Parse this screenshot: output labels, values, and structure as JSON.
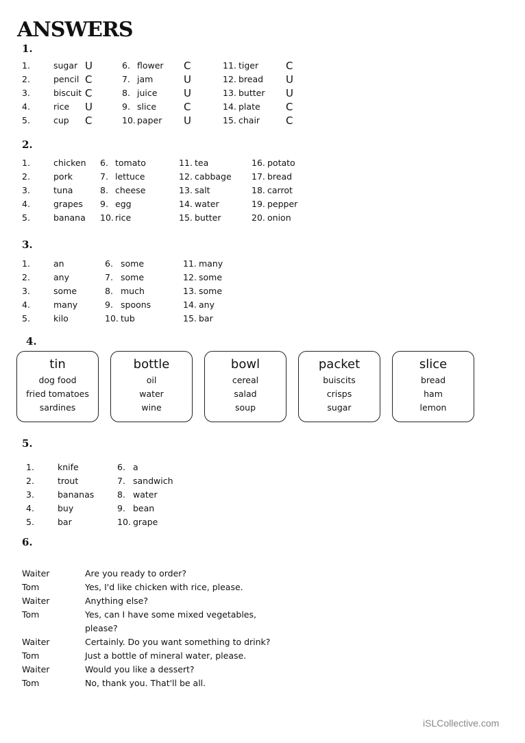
{
  "title": "ANSWERS",
  "footer": "iSLCollective.com",
  "section1": {
    "label": "1.",
    "columns": [
      [
        {
          "n": "1.",
          "word": "sugar",
          "mark": "U"
        },
        {
          "n": "2.",
          "word": "pencil",
          "mark": "C"
        },
        {
          "n": "3.",
          "word": "biscuit",
          "mark": "C"
        },
        {
          "n": "4.",
          "word": "rice",
          "mark": "U"
        },
        {
          "n": "5.",
          "word": "cup",
          "mark": "C"
        }
      ],
      [
        {
          "n": "6.",
          "word": "flower",
          "mark": "C"
        },
        {
          "n": "7.",
          "word": "jam",
          "mark": "U"
        },
        {
          "n": "8.",
          "word": "juice",
          "mark": "U"
        },
        {
          "n": "9.",
          "word": "slice",
          "mark": "C"
        },
        {
          "n": "10.",
          "word": "paper",
          "mark": "U"
        }
      ],
      [
        {
          "n": "11.",
          "word": "tiger",
          "mark": "C"
        },
        {
          "n": "12.",
          "word": "bread",
          "mark": "U"
        },
        {
          "n": "13.",
          "word": "butter",
          "mark": "U"
        },
        {
          "n": "14.",
          "word": "plate",
          "mark": "C"
        },
        {
          "n": "15.",
          "word": "chair",
          "mark": "C"
        }
      ]
    ]
  },
  "section2": {
    "label": "2.",
    "columns": [
      [
        {
          "n": "1.",
          "word": "chicken"
        },
        {
          "n": "2.",
          "word": "pork"
        },
        {
          "n": "3.",
          "word": "tuna"
        },
        {
          "n": "4.",
          "word": "grapes"
        },
        {
          "n": "5.",
          "word": "banana"
        }
      ],
      [
        {
          "n": "6.",
          "word": "tomato"
        },
        {
          "n": "7.",
          "word": "lettuce"
        },
        {
          "n": "8.",
          "word": "cheese"
        },
        {
          "n": "9.",
          "word": "egg"
        },
        {
          "n": "10.",
          "word": "rice"
        }
      ],
      [
        {
          "n": "11.",
          "word": "tea"
        },
        {
          "n": "12.",
          "word": "cabbage"
        },
        {
          "n": "13.",
          "word": "salt"
        },
        {
          "n": "14.",
          "word": "water"
        },
        {
          "n": "15.",
          "word": "butter"
        }
      ],
      [
        {
          "n": "16.",
          "word": "potato"
        },
        {
          "n": "17.",
          "word": "bread"
        },
        {
          "n": "18.",
          "word": "carrot"
        },
        {
          "n": "19.",
          "word": "pepper"
        },
        {
          "n": "20.",
          "word": "onion"
        }
      ]
    ]
  },
  "section3": {
    "label": "3.",
    "columns": [
      [
        {
          "n": "1.",
          "word": "an"
        },
        {
          "n": "2.",
          "word": "any"
        },
        {
          "n": "3.",
          "word": "some"
        },
        {
          "n": "4.",
          "word": "many"
        },
        {
          "n": "5.",
          "word": "kilo"
        }
      ],
      [
        {
          "n": "6.",
          "word": "some"
        },
        {
          "n": "7.",
          "word": "some"
        },
        {
          "n": "8.",
          "word": "much"
        },
        {
          "n": "9.",
          "word": "spoons"
        },
        {
          "n": "10.",
          "word": "tub"
        }
      ],
      [
        {
          "n": "11.",
          "word": "many"
        },
        {
          "n": "12.",
          "word": "some"
        },
        {
          "n": "13.",
          "word": "some"
        },
        {
          "n": "14.",
          "word": "any"
        },
        {
          "n": "15.",
          "word": "bar"
        }
      ]
    ]
  },
  "section4": {
    "label": "4.",
    "boxes": [
      {
        "head": "tin",
        "items": [
          "dog food",
          "fried tomatoes",
          "sardines"
        ]
      },
      {
        "head": "bottle",
        "items": [
          "oil",
          "water",
          "wine"
        ]
      },
      {
        "head": "bowl",
        "items": [
          "cereal",
          "salad",
          "soup"
        ]
      },
      {
        "head": "packet",
        "items": [
          "buiscits",
          "crisps",
          "sugar"
        ]
      },
      {
        "head": "slice",
        "items": [
          "bread",
          "ham",
          "lemon"
        ]
      }
    ]
  },
  "section5": {
    "label": "5.",
    "columns": [
      [
        {
          "n": "1.",
          "word": "knife"
        },
        {
          "n": "2.",
          "word": "trout"
        },
        {
          "n": "3.",
          "word": "bananas"
        },
        {
          "n": "4.",
          "word": "buy"
        },
        {
          "n": "5.",
          "word": "bar"
        }
      ],
      [
        {
          "n": "6.",
          "word": "a"
        },
        {
          "n": "7.",
          "word": "sandwich"
        },
        {
          "n": "8.",
          "word": "water"
        },
        {
          "n": "9.",
          "word": "bean"
        },
        {
          "n": "10.",
          "word": "grape"
        }
      ]
    ]
  },
  "section6": {
    "label": "6.",
    "dialogue": [
      {
        "speaker": "Waiter",
        "line": "Are you ready to order?"
      },
      {
        "speaker": "Tom",
        "line": "Yes, I'd like chicken with rice, please."
      },
      {
        "speaker": "Waiter",
        "line": "Anything else?"
      },
      {
        "speaker": "Tom",
        "line": "Yes, can I have some mixed vegetables,"
      },
      {
        "speaker": "",
        "line": "please?"
      },
      {
        "speaker": "Waiter",
        "line": "Certainly. Do you want something to drink?"
      },
      {
        "speaker": "Tom",
        "line": "Just a bottle of mineral water, please."
      },
      {
        "speaker": "Waiter",
        "line": "Would you like a dessert?"
      },
      {
        "speaker": "Tom",
        "line": "No, thank you. That'll be all."
      }
    ]
  }
}
